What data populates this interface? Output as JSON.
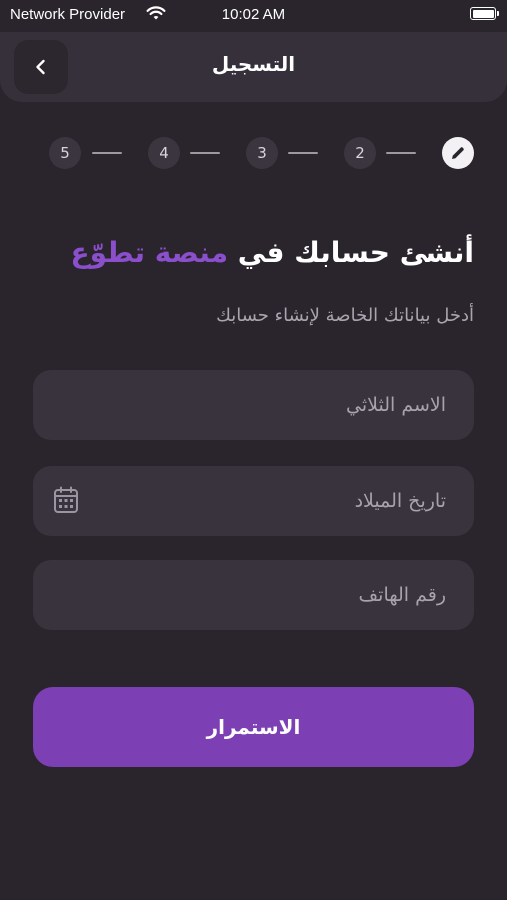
{
  "status_bar": {
    "carrier": "Network Provider",
    "time": "10:02 AM"
  },
  "header": {
    "title": "التسجيل",
    "back_icon": "chevron-left-icon"
  },
  "stepper": {
    "steps": [
      "5",
      "4",
      "3",
      "2"
    ],
    "active_icon": "pencil-icon"
  },
  "heading": {
    "main": "أنشئ حسابك في ",
    "accent": "منصة تطوّع"
  },
  "subheading": "أدخل بياناتك الخاصة لإنشاء حسابك",
  "form": {
    "full_name_placeholder": "الاسم الثلاثي",
    "birth_date_placeholder": "تاريخ الميلاد",
    "phone_placeholder": "رقم الهاتف"
  },
  "continue_label": "الاستمرار",
  "colors": {
    "accent": "#8b4fcb",
    "button": "#7d3fb4",
    "background": "#2a242d"
  }
}
